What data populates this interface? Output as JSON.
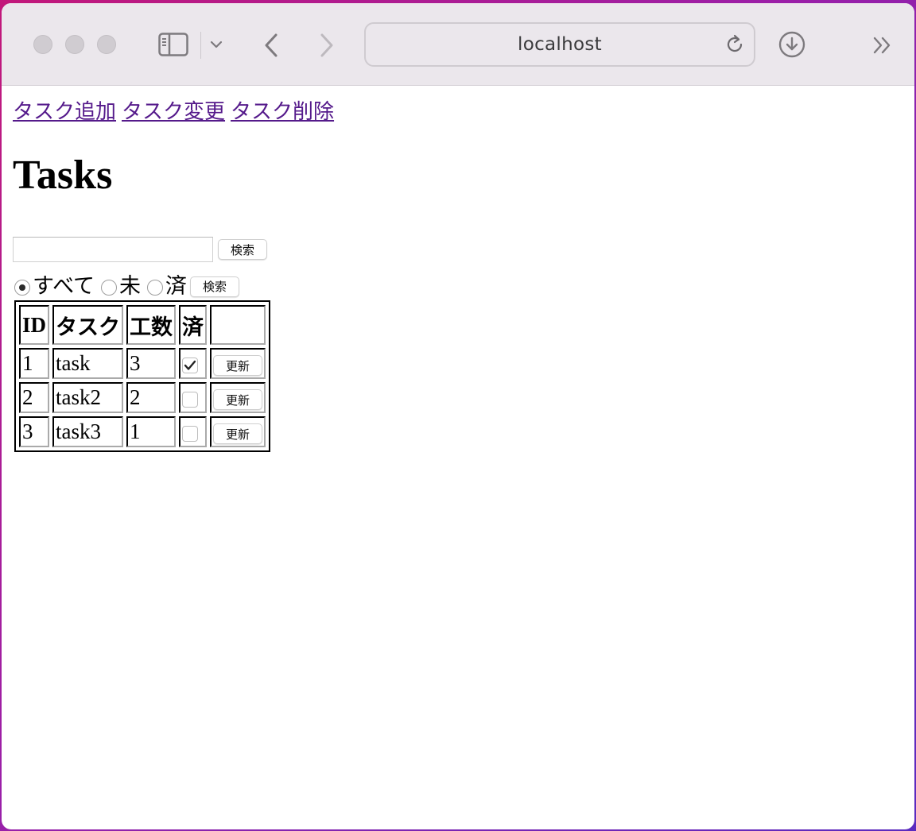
{
  "browser": {
    "address": "localhost",
    "icons": [
      "sidebar-icon",
      "chevron-down-icon",
      "back-icon",
      "forward-icon",
      "reload-icon",
      "download-icon",
      "more-icon"
    ]
  },
  "nav": {
    "links": [
      "タスク追加",
      "タスク変更",
      "タスク削除"
    ]
  },
  "page": {
    "title": "Tasks"
  },
  "search": {
    "value": "",
    "button_label": "検索"
  },
  "filter": {
    "options": [
      {
        "label": "すべて",
        "selected": true
      },
      {
        "label": "未",
        "selected": false
      },
      {
        "label": "済",
        "selected": false
      }
    ],
    "button_label": "検索"
  },
  "table": {
    "headers": [
      "ID",
      "タスク",
      "工数",
      "済",
      ""
    ],
    "rows": [
      {
        "id": "1",
        "task": "task",
        "effort": "3",
        "done": true,
        "button": "更新"
      },
      {
        "id": "2",
        "task": "task2",
        "effort": "2",
        "done": false,
        "button": "更新"
      },
      {
        "id": "3",
        "task": "task3",
        "effort": "1",
        "done": false,
        "button": "更新"
      }
    ]
  },
  "colors": {
    "link": "#551a8b",
    "toolbar": "#ebe7ec"
  }
}
